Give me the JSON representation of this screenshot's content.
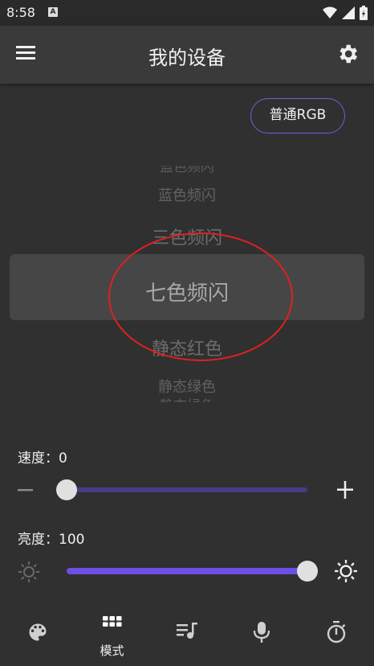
{
  "status_bar": {
    "time": "8:58",
    "badge": "A"
  },
  "app_bar": {
    "title": "我的设备"
  },
  "mode_button": {
    "label": "普通RGB"
  },
  "picker": {
    "items": [
      "蓝色频闪",
      "三色频闪",
      "七色频闪",
      "静态红色",
      "静态绿色"
    ],
    "selected": "七色频闪"
  },
  "speed": {
    "label": "速度：",
    "value": "0",
    "level": 0
  },
  "brightness": {
    "label": "亮度：",
    "value": "100",
    "level": 100
  },
  "bottom_nav": {
    "items": [
      {
        "icon": "palette-icon",
        "label": ""
      },
      {
        "icon": "grid-icon",
        "label": "模式"
      },
      {
        "icon": "playlist-music-icon",
        "label": ""
      },
      {
        "icon": "microphone-icon",
        "label": ""
      },
      {
        "icon": "timer-icon",
        "label": ""
      }
    ],
    "active_index": 1
  },
  "colors": {
    "accent": "#7b5bd8",
    "slider_fill": "#6d4ee6",
    "slider_track": "#4a3a8a",
    "annotation": "#e02020"
  }
}
